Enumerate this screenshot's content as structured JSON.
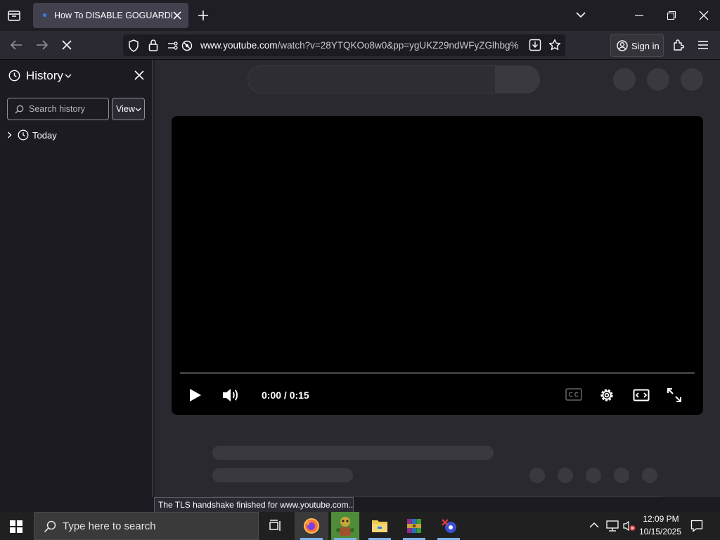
{
  "browser": {
    "tab_title": "How To DISABLE GOGUARDIAN",
    "url_domain": "www.youtube.com",
    "url_path": "/watch?v=28YTQKOo8w0&pp=ygUKZ29ndWFyZGlhbg%",
    "signin_label": "Sign in"
  },
  "sidebar": {
    "title": "History",
    "search_placeholder": "Search history",
    "view_label": "View",
    "groups": [
      {
        "label": "Today"
      }
    ]
  },
  "player": {
    "time": "0:00 / 0:15",
    "progress": 0
  },
  "status_text": "The TLS handshake finished for www.youtube.com...",
  "taskbar": {
    "search_placeholder": "Type here to search",
    "clock_time": "12:09 PM",
    "clock_date": "10/15/2025"
  },
  "icons": {
    "tab_list": "tab-list-icon",
    "new_tab": "plus-icon",
    "back": "arrow-left-icon",
    "forward": "arrow-right-icon",
    "stop": "stop-loading-icon",
    "shield": "tracking-protection-icon",
    "lock": "lock-icon",
    "permissions": "permissions-icon",
    "download": "download-icon",
    "bookmark": "star-icon",
    "account": "account-icon",
    "extensions": "extensions-icon",
    "menu": "hamburger-menu-icon"
  },
  "colors": {
    "accent": "#2f80ed",
    "taskbar_active": "#7fb3e8"
  }
}
